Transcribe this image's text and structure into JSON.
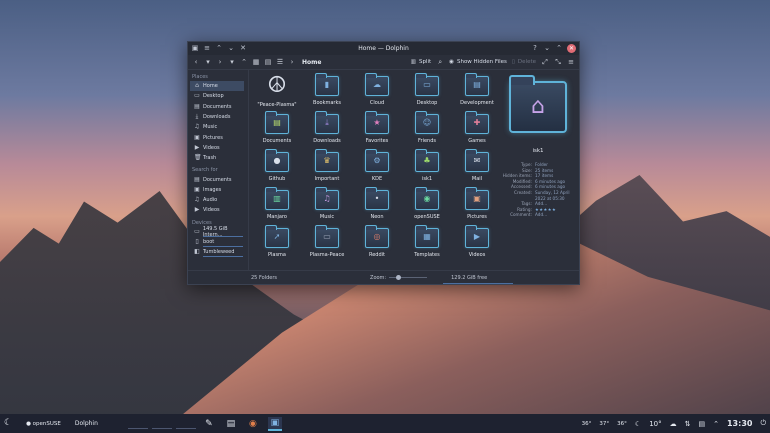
{
  "window": {
    "title": "Home — Dolphin",
    "location": "Home",
    "toolbar": {
      "split": "Split",
      "show_hidden": "Show Hidden Files",
      "delete": "Delete"
    }
  },
  "sidebar": {
    "places_header": "Places",
    "places": [
      {
        "label": "Home",
        "icon": "home-icon",
        "glyph": "⌂",
        "active": true
      },
      {
        "label": "Desktop",
        "icon": "desktop-icon",
        "glyph": "▭"
      },
      {
        "label": "Documents",
        "icon": "documents-icon",
        "glyph": "▤"
      },
      {
        "label": "Downloads",
        "icon": "downloads-icon",
        "glyph": "⤓"
      },
      {
        "label": "Music",
        "icon": "music-icon",
        "glyph": "♫"
      },
      {
        "label": "Pictures",
        "icon": "pictures-icon",
        "glyph": "▣"
      },
      {
        "label": "Videos",
        "icon": "videos-icon",
        "glyph": "▶"
      },
      {
        "label": "Trash",
        "icon": "trash-icon",
        "glyph": "🗑"
      }
    ],
    "search_header": "Search for",
    "search": [
      {
        "label": "Documents",
        "icon": "documents-icon",
        "glyph": "▤"
      },
      {
        "label": "Images",
        "icon": "images-icon",
        "glyph": "▣"
      },
      {
        "label": "Audio",
        "icon": "audio-icon",
        "glyph": "♫"
      },
      {
        "label": "Videos",
        "icon": "videos-icon",
        "glyph": "▶"
      }
    ],
    "devices_header": "Devices",
    "devices": [
      {
        "label": "149.5 GiB Intern...",
        "icon": "drive-icon",
        "glyph": "▭"
      },
      {
        "label": "boot",
        "icon": "drive-icon",
        "glyph": "▯"
      },
      {
        "label": "Tumbleweed",
        "icon": "drive-icon",
        "glyph": "◧"
      }
    ]
  },
  "folders": [
    {
      "label": "\"Peace-Plasma\"",
      "glyph": "☮",
      "color": "#d8dee9",
      "peace": true
    },
    {
      "label": "Bookmarks",
      "glyph": "▮",
      "color": "#7fb1e0"
    },
    {
      "label": "Cloud",
      "glyph": "☁",
      "color": "#7fb1e0"
    },
    {
      "label": "Desktop",
      "glyph": "▭",
      "color": "#7fb1e0"
    },
    {
      "label": "Development",
      "glyph": "▤",
      "color": "#7fb1e0"
    },
    {
      "label": "Documents",
      "glyph": "▤",
      "color": "#b5d86b"
    },
    {
      "label": "Downloads",
      "glyph": "⤓",
      "color": "#a58be0"
    },
    {
      "label": "Favorites",
      "glyph": "★",
      "color": "#e07fbf"
    },
    {
      "label": "Friends",
      "glyph": "☺",
      "color": "#7fb1e0"
    },
    {
      "label": "Games",
      "glyph": "✚",
      "color": "#e07f9a"
    },
    {
      "label": "Github",
      "glyph": "●",
      "color": "#d8dee9"
    },
    {
      "label": "Important",
      "glyph": "♛",
      "color": "#e0c06b"
    },
    {
      "label": "KDE",
      "glyph": "⚙",
      "color": "#7fb1e0"
    },
    {
      "label": "isk1",
      "glyph": "♣",
      "color": "#9bd86b"
    },
    {
      "label": "Mail",
      "glyph": "✉",
      "color": "#d8dee9"
    },
    {
      "label": "Manjaro",
      "glyph": "▥",
      "color": "#6bd8a0"
    },
    {
      "label": "Music",
      "glyph": "♫",
      "color": "#c69be0"
    },
    {
      "label": "Neon",
      "glyph": "•",
      "color": "#d8dee9"
    },
    {
      "label": "openSUSE",
      "glyph": "◉",
      "color": "#6bd8a0"
    },
    {
      "label": "Pictures",
      "glyph": "▣",
      "color": "#e0a07f"
    },
    {
      "label": "Plasma",
      "glyph": "➚",
      "color": "#7fb1e0"
    },
    {
      "label": "Plasma-Peace",
      "glyph": "▭",
      "color": "#9aa3b5"
    },
    {
      "label": "Reddit",
      "glyph": "◎",
      "color": "#e07f6b"
    },
    {
      "label": "Templates",
      "glyph": "▦",
      "color": "#7fb1e0"
    },
    {
      "label": "Videos",
      "glyph": "▶",
      "color": "#7fb1e0"
    }
  ],
  "info": {
    "name": "isk1",
    "meta": [
      {
        "key": "Type:",
        "value": "Folder"
      },
      {
        "key": "Size:",
        "value": "25 items"
      },
      {
        "key": "Hidden items:",
        "value": "17 items"
      },
      {
        "key": "Modified:",
        "value": "6 minutes ago"
      },
      {
        "key": "Accessed:",
        "value": "6 minutes ago"
      },
      {
        "key": "Created:",
        "value": "Sunday, 12 April 2022 at 05:30"
      },
      {
        "key": "Tags:",
        "value": "Add..."
      },
      {
        "key": "Rating:",
        "value": "★★★★★"
      },
      {
        "key": "Comment:",
        "value": "Add..."
      }
    ]
  },
  "status": {
    "count": "25 Folders",
    "zoom_label": "Zoom:",
    "free": "129.2 GiB free",
    "zoom_level": 0.25
  },
  "taskbar": {
    "activity": "openSUSE",
    "app": "Dolphin",
    "temps": [
      "36°",
      "37°",
      "36°"
    ],
    "weather": "10°",
    "clock": "13:30"
  }
}
